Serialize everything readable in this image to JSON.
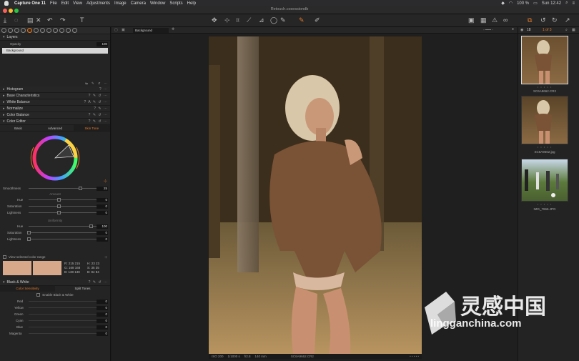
{
  "menubar": {
    "app": "Capture One 11",
    "items": [
      "File",
      "Edit",
      "View",
      "Adjustments",
      "Image",
      "Camera",
      "Window",
      "Scripts",
      "Help"
    ],
    "battery": "100 %",
    "clock": "Sun 12:42"
  },
  "window": {
    "title": "Retouch.cosessiondb"
  },
  "viewer": {
    "tool_tab": "Background",
    "counter": "1 of 3",
    "count_badge": "18"
  },
  "left": {
    "layers": {
      "header": "Layers",
      "opacity_label": "Opacity",
      "opacity_value": "100",
      "layer_name": "Background"
    },
    "sections": [
      "Histogram",
      "Base Characteristics",
      "White Balance",
      "Normalize",
      "Color Balance",
      "Color Editor"
    ],
    "color_editor": {
      "tabs": [
        "Basic",
        "Advanced",
        "Skin Tone"
      ],
      "smoothness_label": "Smoothness",
      "smoothness_value": "25",
      "amount_label": "Amount",
      "amount_rows": [
        {
          "label": "Hue",
          "value": "0"
        },
        {
          "label": "Saturation",
          "value": "0"
        },
        {
          "label": "Lightness",
          "value": "0"
        }
      ],
      "uniformity_label": "Uniformity",
      "uniformity_rows": [
        {
          "label": "Hue",
          "value": "100"
        },
        {
          "label": "Saturation",
          "value": "0"
        },
        {
          "label": "Lightness",
          "value": "0"
        }
      ],
      "view_range_label": "View selected color range",
      "readout": {
        "r": "R: 215 215",
        "g": "G: 168 168",
        "b": "B: 138 138",
        "h": "H: 23 23",
        "s": "S: 35 35",
        "bv": "B: 84 84"
      },
      "swatch_color": "#d7a88a"
    },
    "bw": {
      "header": "Black & White",
      "tabs": [
        "Color Sensitivity",
        "Split Tones"
      ],
      "enable_label": "Enable Black & White",
      "rows": [
        {
          "label": "Red",
          "value": "0"
        },
        {
          "label": "Yellow",
          "value": "0"
        },
        {
          "label": "Green",
          "value": "0"
        },
        {
          "label": "Cyan",
          "value": "0"
        },
        {
          "label": "Blue",
          "value": "0"
        },
        {
          "label": "Magenta",
          "value": "0"
        }
      ]
    }
  },
  "status": {
    "iso": "ISO 200",
    "shutter": "1/1000 s",
    "aperture": "f/2.8",
    "focal": "140 mm",
    "file": "SC6A9662.CR2"
  },
  "browser": [
    {
      "name": "SC6A9662.CR2",
      "dots": "• • • • •"
    },
    {
      "name": "SC6A9662.jpg",
      "dots": "• • • • •"
    },
    {
      "name": "IMG_7666.JPG",
      "dots": "• • • • •"
    }
  ],
  "watermark": {
    "cn": "灵感中国",
    "url": "lingganchina.com"
  },
  "colors": {
    "accent": "#e07a2c",
    "panel": "#242424"
  }
}
